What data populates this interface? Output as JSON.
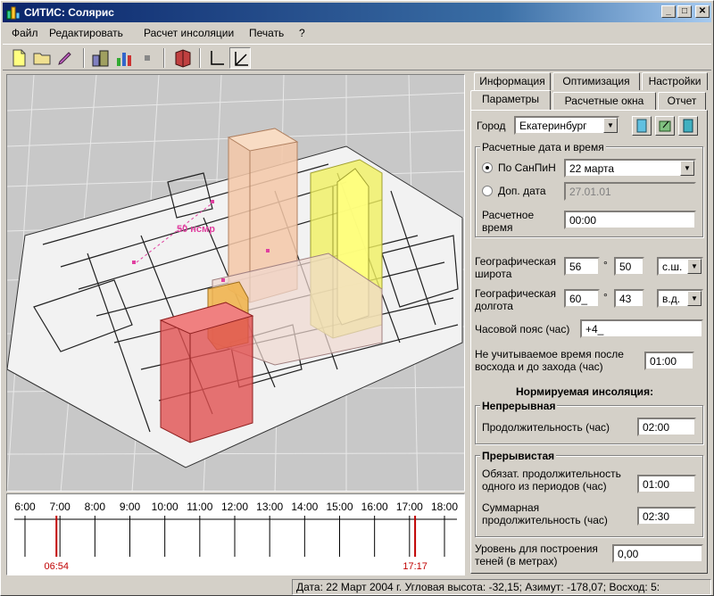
{
  "window": {
    "title": "СИТИС: Солярис",
    "minimize": "_",
    "maximize": "□",
    "close": "✕"
  },
  "menu": [
    "Файл",
    "Редактировать",
    "Расчет инсоляции",
    "Печать",
    "?"
  ],
  "toolbar_icons": [
    "new-file-icon",
    "open-folder-icon",
    "pen-icon",
    "buildings-icon",
    "chart-icon",
    "stop-icon",
    "book-icon",
    "axis-icon",
    "angle-icon"
  ],
  "viewport": {
    "label": "50 нсмр"
  },
  "timeline": {
    "hours": [
      "6:00",
      "7:00",
      "8:00",
      "9:00",
      "10:00",
      "11:00",
      "12:00",
      "13:00",
      "14:00",
      "15:00",
      "16:00",
      "17:00",
      "18:00"
    ],
    "sunrise": "06:54",
    "sunset": "17:17",
    "sunrise_fraction": 0.075,
    "sunset_fraction": 0.93
  },
  "tabs_row1": [
    "Информация",
    "Оптимизация",
    "Настройки"
  ],
  "tabs_row2": [
    "Параметры",
    "Расчетные окна",
    "Отчет"
  ],
  "params": {
    "city_label": "Город",
    "city_value": "Екатеринбург",
    "date_group_title": "Расчетные дата и время",
    "by_snip_label": "По СанПиН",
    "by_snip_value": "22 марта",
    "extra_date_label": "Доп. дата",
    "extra_date_value": "27.01.01",
    "calc_time_label": "Расчетное время",
    "calc_time_value": "00:00",
    "lat_label": "Географическая широта",
    "lat_deg": "56",
    "lat_min": "50",
    "lat_dir": "с.ш.",
    "lon_label": "Географическая долгота",
    "lon_deg": "60_",
    "lon_min": "43",
    "lon_dir": "в.д.",
    "tz_label": "Часовой пояс (час)",
    "tz_value": "+4_",
    "ignored_time_label": "Не учитываемое время после восхода и до захода (час)",
    "ignored_time_value": "01:00",
    "normative_title": "Нормируемая инсоляция:",
    "continuous_title": "Непрерывная",
    "continuous_label": "Продолжительность (час)",
    "continuous_value": "02:00",
    "interrupted_title": "Прерывистая",
    "mandatory_label": "Обязат. продолжительность одного из периодов (час)",
    "mandatory_value": "01:00",
    "total_label": "Суммарная продолжительность (час)",
    "total_value": "02:30",
    "shadow_label": "Уровень для построения теней (в метрах)",
    "shadow_value": "0,00",
    "degree_sign": "°"
  },
  "status": [
    "Дата: 22 Март 2004 г.",
    "Угловая высота: -32,15;",
    "Азимут: -178,07;",
    "Восход: 5:"
  ],
  "colors": {
    "titlebar": "#0a246a",
    "sun_line": "#c00000",
    "building_red": "#e05050",
    "building_peach": "#f4c8a8",
    "building_yellow": "#f0f060"
  }
}
